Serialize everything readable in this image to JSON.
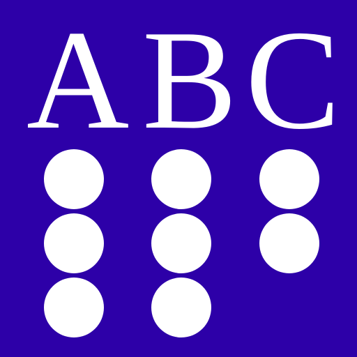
{
  "logo": {
    "letters": [
      "A",
      "B",
      "C"
    ],
    "colors": {
      "background": "#2d00a8",
      "foreground": "#ffffff"
    }
  },
  "braille": {
    "dots_per_column": [
      3,
      3,
      2
    ]
  }
}
